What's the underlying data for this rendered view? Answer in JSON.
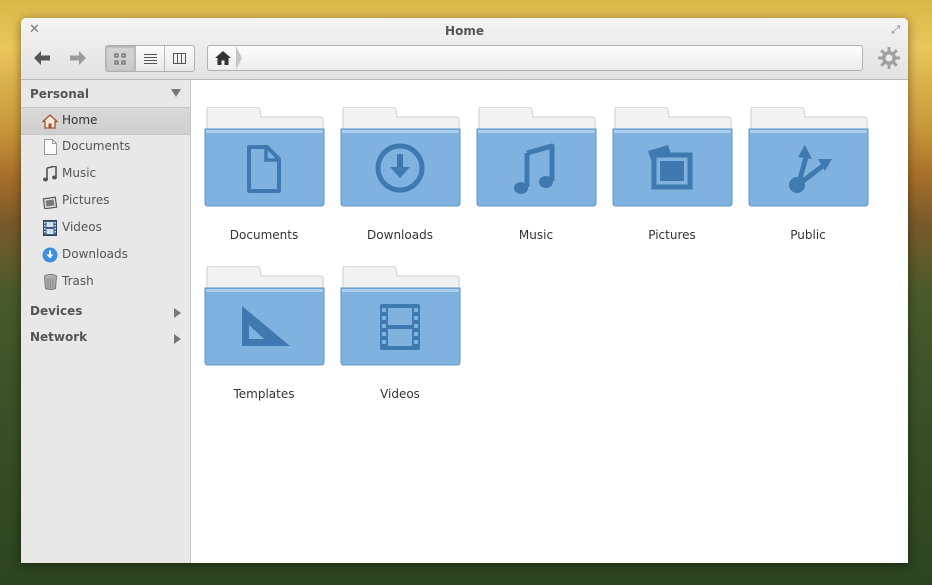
{
  "window": {
    "title": "Home"
  },
  "toolbar": {
    "back_icon": "arrow-left-icon",
    "forward_icon": "arrow-right-icon",
    "view_modes": [
      "icon-view",
      "list-view",
      "column-view"
    ],
    "active_view": "icon-view",
    "path": [
      "home-icon"
    ],
    "settings_icon": "gear-icon"
  },
  "sidebar": {
    "sections": [
      {
        "label": "Personal",
        "expanded": true
      },
      {
        "label": "Devices",
        "expanded": false
      },
      {
        "label": "Network",
        "expanded": false
      }
    ],
    "items": [
      {
        "label": "Home",
        "icon": "home-icon",
        "selected": true
      },
      {
        "label": "Documents",
        "icon": "document-icon"
      },
      {
        "label": "Music",
        "icon": "music-note-icon"
      },
      {
        "label": "Pictures",
        "icon": "picture-icon"
      },
      {
        "label": "Videos",
        "icon": "film-icon"
      },
      {
        "label": "Downloads",
        "icon": "download-icon"
      },
      {
        "label": "Trash",
        "icon": "trash-icon"
      }
    ]
  },
  "folders": [
    {
      "label": "Documents",
      "icon": "document-icon"
    },
    {
      "label": "Downloads",
      "icon": "download-icon"
    },
    {
      "label": "Music",
      "icon": "music-note-icon"
    },
    {
      "label": "Pictures",
      "icon": "picture-icon"
    },
    {
      "label": "Public",
      "icon": "share-icon"
    },
    {
      "label": "Templates",
      "icon": "set-square-icon"
    },
    {
      "label": "Videos",
      "icon": "film-icon"
    }
  ],
  "colors": {
    "folder": "#7fb2de",
    "folder_dark": "#4f88bf",
    "selection": "#d3d3d3",
    "accent": "#4a90d9"
  }
}
